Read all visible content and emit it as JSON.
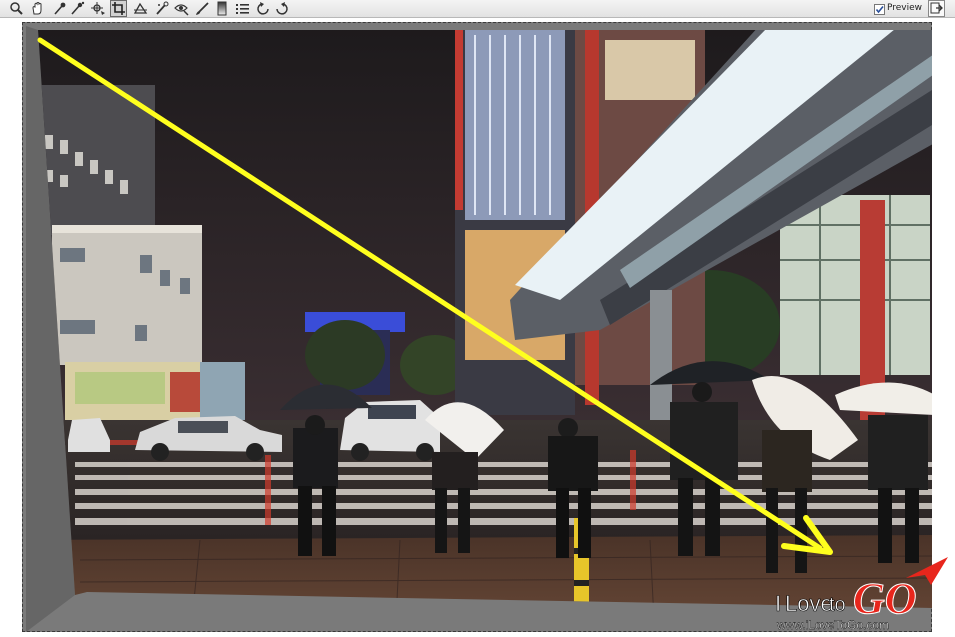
{
  "toolbar": {
    "tools": [
      {
        "name": "zoom-tool",
        "icon": "magnifier-icon"
      },
      {
        "name": "hand-tool",
        "icon": "hand-icon"
      },
      {
        "name": "eyedropper-tool",
        "icon": "eyedropper-icon"
      },
      {
        "name": "color-sampler-tool",
        "icon": "color-sampler-icon"
      },
      {
        "name": "targeted-adjustment-tool",
        "icon": "target-icon"
      },
      {
        "name": "crop-tool",
        "icon": "crop-icon",
        "active": true
      },
      {
        "name": "straighten-tool",
        "icon": "straighten-icon"
      },
      {
        "name": "spot-removal-tool",
        "icon": "spot-icon"
      },
      {
        "name": "red-eye-tool",
        "icon": "red-eye-icon"
      },
      {
        "name": "adjustment-brush-tool",
        "icon": "brush-icon"
      },
      {
        "name": "graduated-filter-tool",
        "icon": "gradient-icon"
      },
      {
        "name": "preferences-tool",
        "icon": "list-icon"
      },
      {
        "name": "rotate-left-tool",
        "icon": "rotate-left-icon"
      },
      {
        "name": "rotate-right-tool",
        "icon": "rotate-right-icon"
      }
    ],
    "preview_label": "Preview",
    "preview_checked": true
  },
  "watermark": {
    "logo_i": "I",
    "logo_love": "Love",
    "logo_to": "to",
    "logo_go": "GO",
    "url": "www.iLoveToGo.com"
  },
  "colors": {
    "annotation_arrow": "#ffff1e",
    "canvas_bg": "#7a7a7a",
    "logo_red": "#e8261c"
  }
}
